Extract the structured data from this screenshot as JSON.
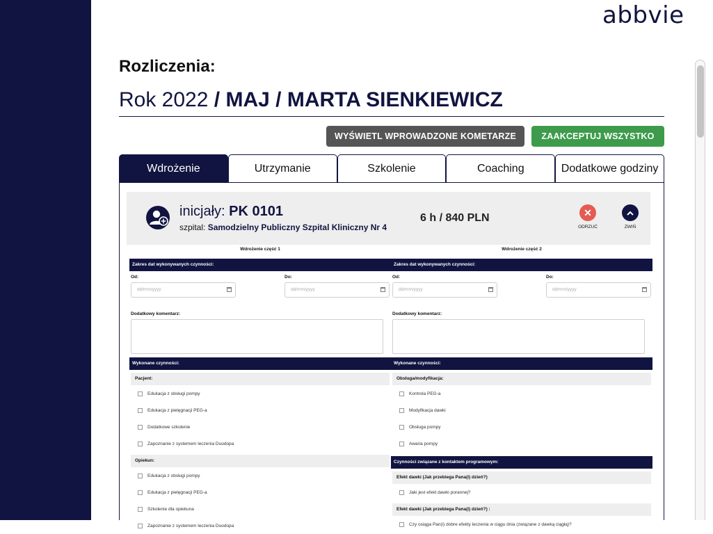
{
  "brand": {
    "logo_text": "abbvie",
    "sidebar_color": "#111440",
    "accent": "#111440"
  },
  "header": {
    "section_title": "Rozliczenia:",
    "year_text": "Rok 2022",
    "sep1": "/",
    "month": "MAJ",
    "sep2": "/",
    "person": "MARTA SIENKIEWICZ"
  },
  "actions": {
    "show_comments_label": "WYŚWIETL WPROWADZONE KOMETARZE",
    "accept_all_label": "ZAAKCEPTUJ WSZYSTKO",
    "show_comments_color": "#555555",
    "accept_all_color": "#3d9b4b"
  },
  "tabs": [
    {
      "label": "Wdrożenie",
      "active": true
    },
    {
      "label": "Utrzymanie",
      "active": false
    },
    {
      "label": "Szkolenie",
      "active": false
    },
    {
      "label": "Coaching",
      "active": false
    },
    {
      "label": "Dodatkowe godziny",
      "active": false
    }
  ],
  "patient": {
    "initials_label": "inicjały:",
    "initials_value": "PK 0101",
    "hospital_label": "szpital:",
    "hospital_value": "Samodzielny Publiczny Szpital Kliniczny Nr 4",
    "summary": "6 h / 840 PLN",
    "reject_label": "ODRZUĆ",
    "collapse_label": "ZWIŃ",
    "avatar_icon": "user-plus-icon"
  },
  "parts": [
    {
      "title": "Wdrożenie część 1",
      "date_range_header": "Zakres dat wykonywanych czynności:",
      "from_label": "Od:",
      "to_label": "Do:",
      "from_placeholder": "dd/mm/yyyy",
      "to_placeholder": "dd/mm/yyyy",
      "comment_label": "Dodatkowy komentarz:",
      "activities_header": "Wykonane czynności:",
      "groups": [
        {
          "title": "Pacjent:",
          "items": [
            "Edukacja z obsługi pompy",
            "Edukacja z pielęgnacji PEG-a",
            "Dodatkowe szkolenie",
            "Zapoznanie z systemem leczenia Duodopa"
          ]
        },
        {
          "title": "Opiekun:",
          "items": [
            "Edukacja z obsługi pompy",
            "Edukacja z pielęgnacji PEG-a",
            "Szkolenie dla opiekuna",
            "Zapoznanie z systemem leczenia Duodopa"
          ]
        }
      ]
    },
    {
      "title": "Wdrożenie część 2",
      "date_range_header": "Zakres dat wykonywanych czynności:",
      "from_label": "Od:",
      "to_label": "Do:",
      "from_placeholder": "dd/mm/yyyy",
      "to_placeholder": "dd/mm/yyyy",
      "comment_label": "Dodatkowy komentarz:",
      "activities_header": "Wykonane czynności:",
      "groups": [
        {
          "title": "Obsługa/modyfikacja:",
          "items": [
            "Kontrola PEG-a",
            "Modyfikacja dawki",
            "Obsługa pompy",
            "Awaria pompy"
          ]
        }
      ],
      "program_header": "Czynności związane z kontaktem programowym:",
      "program_groups": [
        {
          "title": "Efekt dawki (Jak przebiega Pana(i) dzień?)",
          "items": [
            "Jaki jest efekt dawki porannej?"
          ]
        },
        {
          "title": "Efekt dawki (Jak przebiega Pana(i) dzień?) :",
          "items": [
            "Czy osiąga Pan(i) dobre efekty leczenia w ciągu dnia (związane z dawką ciągłą)?"
          ]
        }
      ]
    }
  ]
}
